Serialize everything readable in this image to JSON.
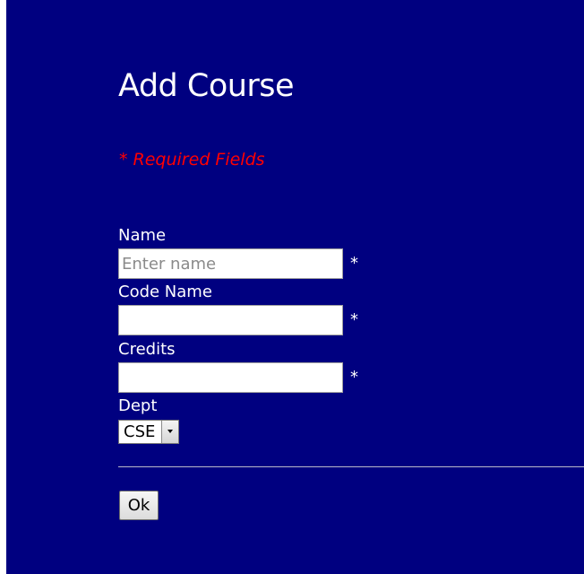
{
  "form": {
    "title": "Add Course",
    "required_note": "* Required Fields",
    "fields": {
      "name": {
        "label": "Name",
        "value": "",
        "placeholder": "Enter name",
        "required_mark": "*"
      },
      "code_name": {
        "label": "Code Name",
        "value": "",
        "placeholder": "",
        "required_mark": "*"
      },
      "credits": {
        "label": "Credits",
        "value": "",
        "placeholder": "",
        "required_mark": "*"
      },
      "dept": {
        "label": "Dept",
        "selected": "CSE"
      }
    },
    "submit_label": "Ok"
  },
  "colors": {
    "background": "#000080",
    "text": "#ffffff",
    "required_note": "#ff0000"
  },
  "icons": {
    "dropdown": "chevron-down-icon"
  }
}
